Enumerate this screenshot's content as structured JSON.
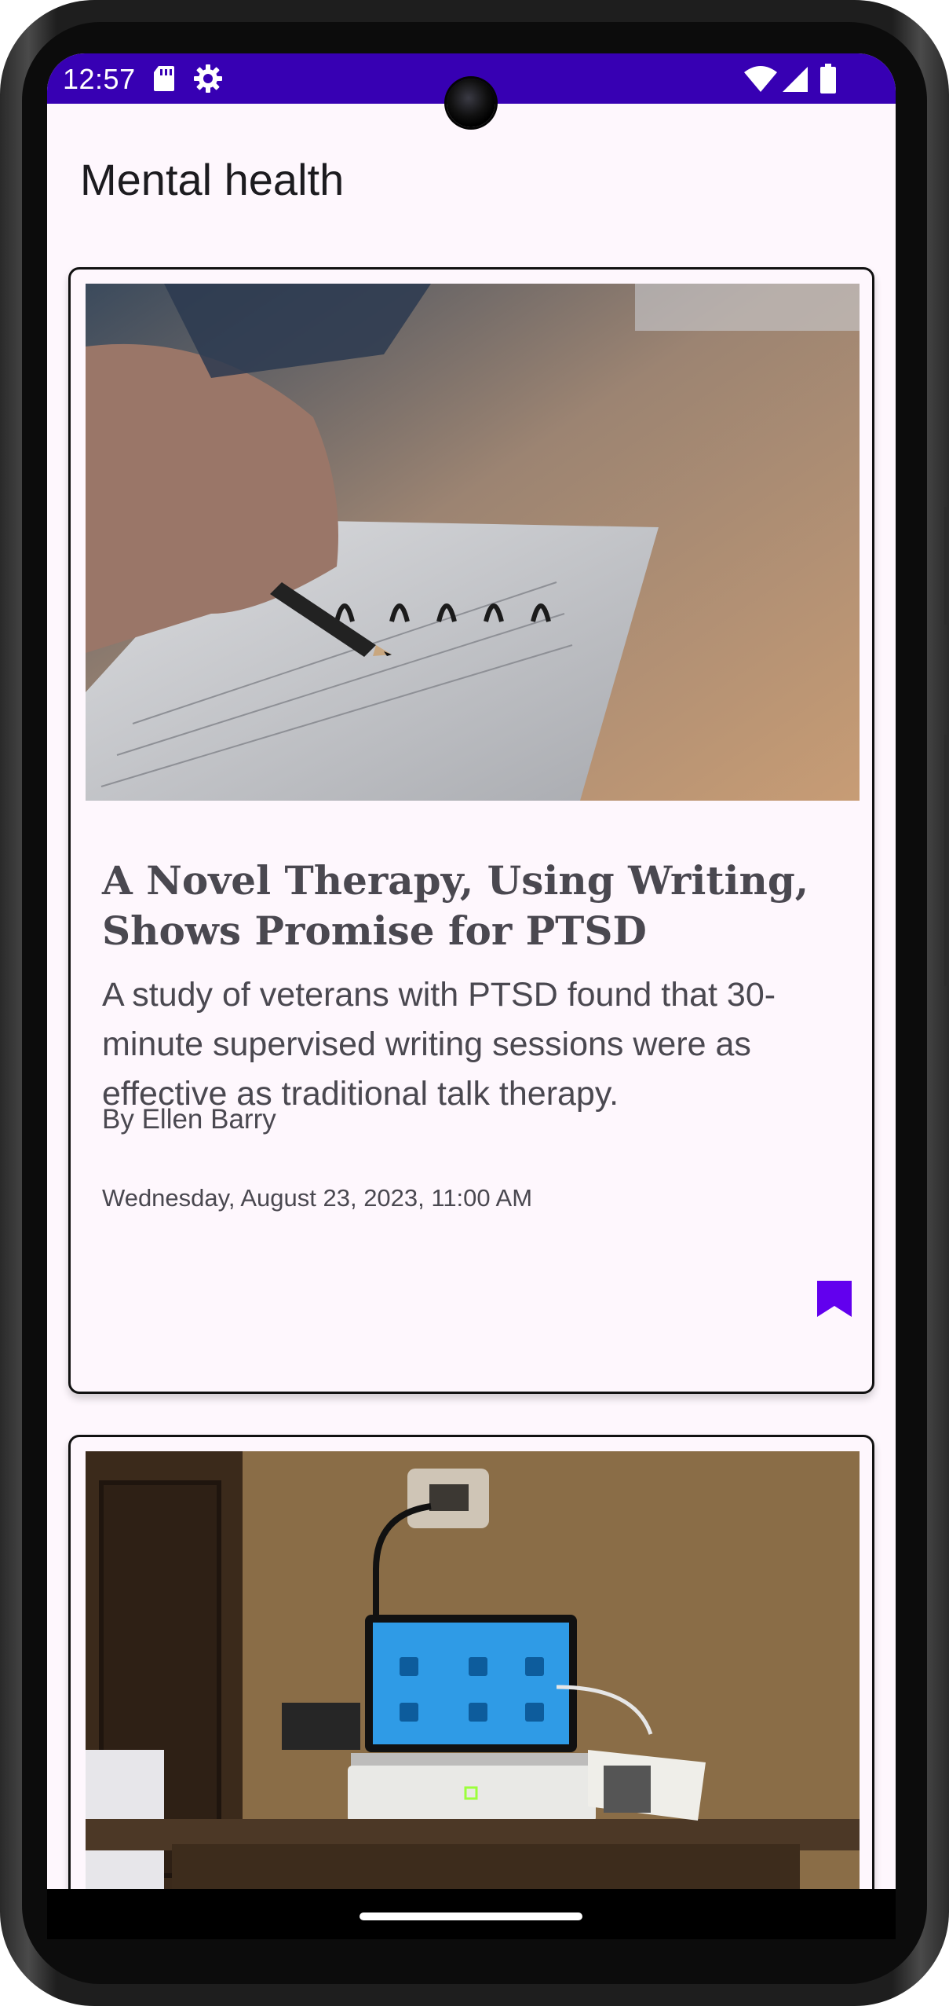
{
  "status_bar": {
    "time": "12:57",
    "left_icons": [
      "sd-card-icon",
      "settings-gear-icon"
    ],
    "right_icons": [
      "wifi-icon",
      "cellular-signal-icon",
      "battery-icon"
    ],
    "background_color": "#3700b3"
  },
  "app_bar": {
    "title": "Mental health"
  },
  "articles": [
    {
      "image": "photo-hand-writing-in-notebook",
      "headline": "A Novel Therapy, Using Writing, Shows Promise for PTSD",
      "summary": "A study of veterans with PTSD found that 30-minute supervised writing sessions were as effective as traditional talk therapy.",
      "byline": "By Ellen Barry",
      "date": "Wednesday, August 23, 2023, 11:00 AM",
      "bookmark_icon": "bookmark-filled-icon",
      "bookmarked": true
    },
    {
      "image": "photo-tablet-device-on-nightstand"
    }
  ],
  "colors": {
    "accent": "#6200ee",
    "screen_background": "#fef7fd",
    "text_primary": "#1c1b1f",
    "text_secondary": "#4a4850"
  }
}
